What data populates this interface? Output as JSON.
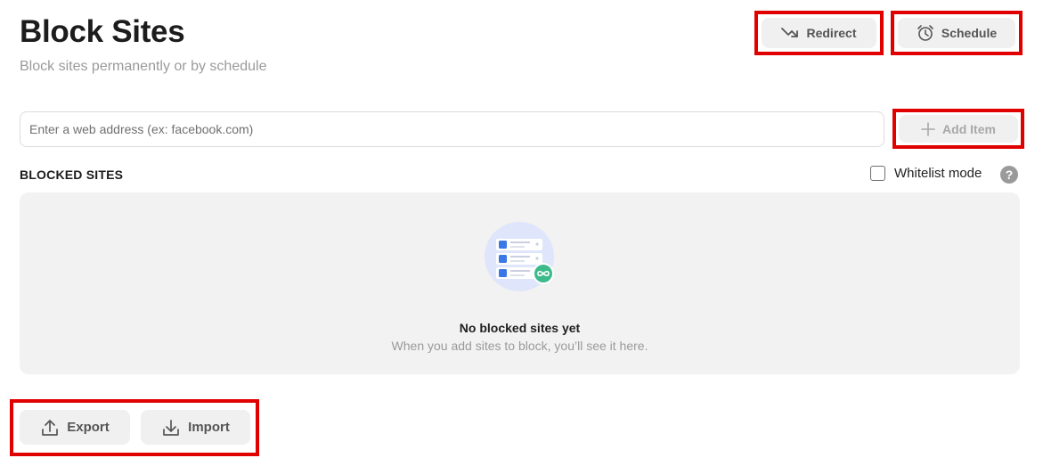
{
  "header": {
    "title": "Block Sites",
    "subtitle": "Block sites permanently or by schedule"
  },
  "actions": {
    "redirect_label": "Redirect",
    "schedule_label": "Schedule"
  },
  "address_input": {
    "value": "",
    "placeholder": "Enter a web address (ex: facebook.com)"
  },
  "add_item_label": "Add Item",
  "blocked_sites": {
    "section_label": "BLOCKED SITES",
    "whitelist_label": "Whitelist mode",
    "whitelist_checked": false,
    "help_glyph": "?",
    "empty_title": "No blocked sites yet",
    "empty_description": "When you add sites to block, you’ll see it here."
  },
  "footer": {
    "export_label": "Export",
    "import_label": "Import"
  },
  "colors": {
    "highlight": "#e00000",
    "button_bg": "#f0f0f0",
    "panel_bg": "#f2f2f2",
    "illustration_blue": "#3b78e7",
    "illustration_circle": "#dfe5fb",
    "illustration_green": "#3dba8c"
  },
  "icons": {
    "redirect": "redirect-arrow-icon",
    "schedule": "alarm-clock-icon",
    "add": "plus-icon",
    "help": "question-circle-icon",
    "export": "upload-icon",
    "import": "download-icon",
    "empty_state": "blocked-list-illustration"
  }
}
